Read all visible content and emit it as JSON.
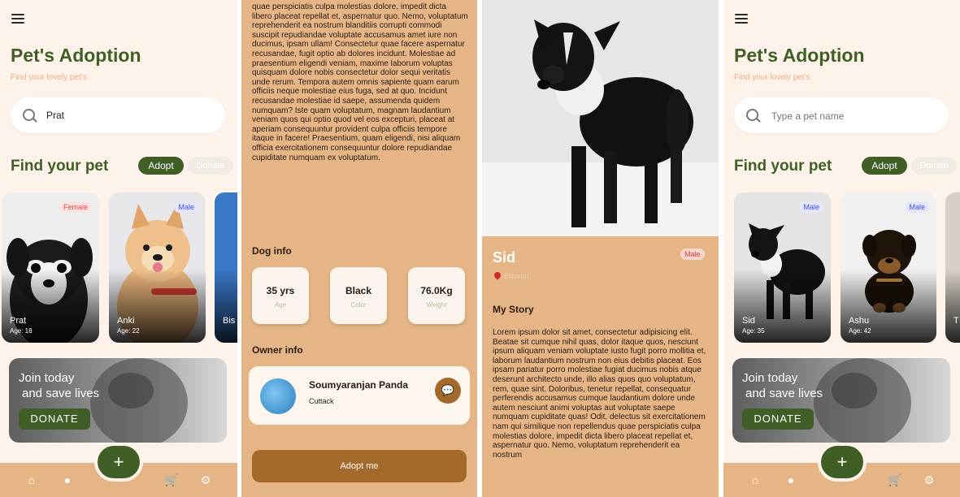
{
  "colors": {
    "primary_green": "#3f5f26",
    "cream_bg": "#fdf3ea",
    "tan_bg": "#e6b585",
    "brown_button": "#a36a2c",
    "subtitle_peach": "#efaa80"
  },
  "screens": [
    {
      "title": "Pet's Adoption",
      "subtitle": "Find your lovely pet's",
      "search_value": "Prat",
      "section_title": "Find your pet",
      "tabs": {
        "adopt": "Adopt",
        "donate": "Donate"
      },
      "cards": [
        {
          "name": "Prat",
          "age": "Age: 18",
          "gender": "Female"
        },
        {
          "name": "Anki",
          "age": "Age: 22",
          "gender": "Male"
        },
        {
          "name": "Bis",
          "age": "",
          "gender": ""
        }
      ],
      "banner": {
        "line1": "Join today",
        "line2": "and save lives",
        "button": "DONATE"
      },
      "nav_icons": [
        "home-icon",
        "user-icon",
        "cart-icon",
        "settings-icon"
      ],
      "fab_icon": "+"
    },
    {
      "story_text": "quae perspiciatis culpa molestias dolore, impedit dicta libero placeat repellat et, aspernatur quo. Nemo, voluptatum reprehenderit ea nostrum blanditiis corrupti commodi suscipit repudiandae voluptate accusamus amet iure non ducimus, ipsam ullam! Consectetur quae facere aspernatur recusandae, fugit optio ab dolores incidunt. Molestiae ad praesentium eligendi veniam, maxime laborum voluptas quisquam dolore nobis consectetur dolor sequi veritatis unde rerum. Tempora autem omnis sapiente quam earum officiis neque molestiae eius fuga, sed at quo. Incidunt recusandae molestiae id saepe, assumenda quidem numquam? Iste quam voluptatum, magnam laudantium veniam quos qui optio quod vel eos excepturi, placeat at aperiam consequuntur provident culpa officiis tempore itaque in facere! Praesentium, quam eligendi, nisi aliquam officia exercitationem consequuntur dolore repudiandae cupiditate numquam ex voluptatum.",
      "dog_info_title": "Dog info",
      "info": [
        {
          "value": "35 yrs",
          "label": "Age"
        },
        {
          "value": "Black",
          "label": "Color"
        },
        {
          "value": "76.0Kg",
          "label": "Weight"
        }
      ],
      "owner_info_title": "Owner info",
      "owner": {
        "name": "Soumyaranjan Panda",
        "city": "Cuttack"
      },
      "adopt_button": "Adopt me"
    },
    {
      "pet_name": "Sid",
      "gender": "Male",
      "location": "Bhuvan",
      "my_story_title": "My Story",
      "story_text": "Lorem ipsum dolor sit amet, consectetur adipisicing elit. Beatae sit cumque nihil quas, dolor itaque quos, nesciunt ipsum aliquam veniam voluptate iusto fugit porro mollitia et, laborum laudantium nostrum non eius debitis placeat. Eos ipsam pariatur porro molestiae fugiat ducimus nobis atque deserunt architecto unde, illo alias quos quo voluptatum, rem, quae sint. Doloribus, tenetur repellat, consequatur perferendis accusamus cumque laudantium dolore unde autem nesciunt animi voluptas aut voluptate saepe numquam cupiditate quas! Odit, delectus sit exercitationem nam qui similique non repellendus quae perspiciatis culpa molestias dolore, impedit dicta libero placeat repellat et, aspernatur quo. Nemo, voluptatum reprehenderit ea nostrum"
    },
    {
      "title": "Pet's Adoption",
      "subtitle": "Find your lovely pet's",
      "search_placeholder": "Type a pet name",
      "section_title": "Find your pet",
      "tabs": {
        "adopt": "Adopt",
        "donate": "Donate"
      },
      "cards": [
        {
          "name": "Sid",
          "age": "Age: 35",
          "gender": "Male"
        },
        {
          "name": "Ashu",
          "age": "Age: 42",
          "gender": "Male"
        },
        {
          "name": "T",
          "age": "",
          "gender": ""
        }
      ],
      "banner": {
        "line1": "Join today",
        "line2": "and save lives",
        "button": "DONATE"
      },
      "nav_icons": [
        "home-icon",
        "user-icon",
        "cart-icon",
        "settings-icon"
      ],
      "fab_icon": "+"
    }
  ]
}
